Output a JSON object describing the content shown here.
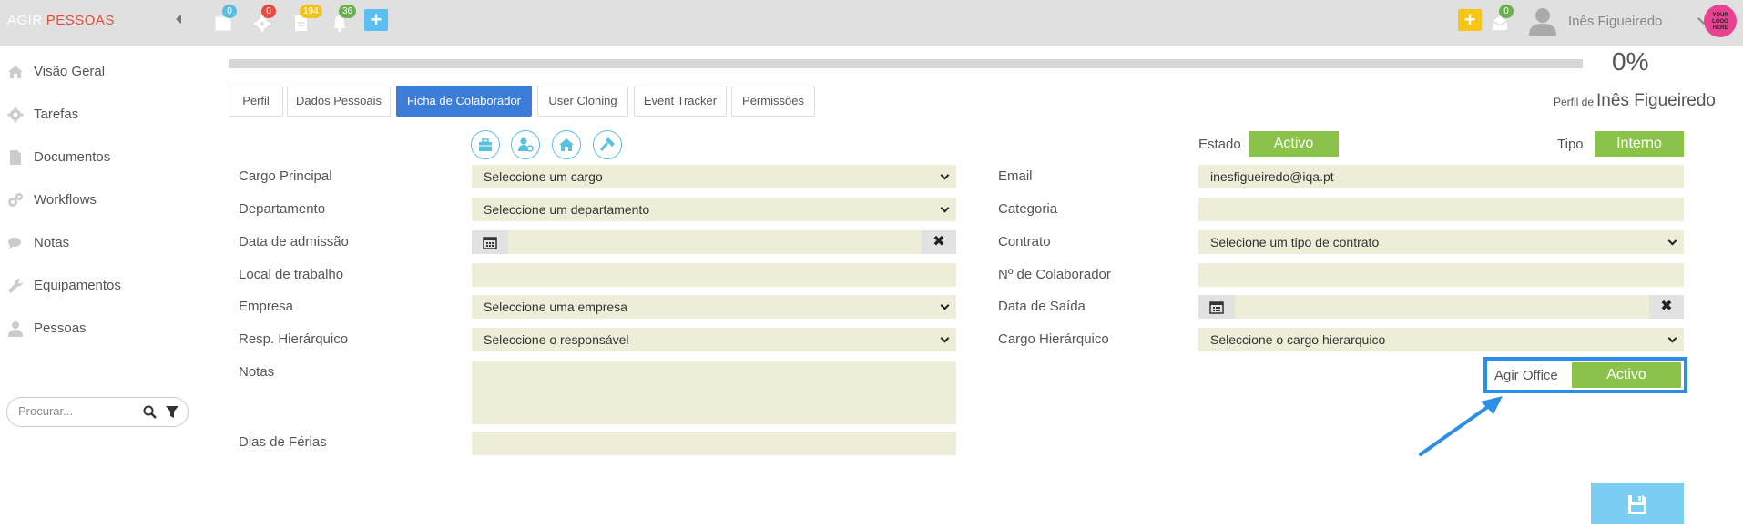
{
  "header": {
    "brand_part1": "AGIR",
    "brand_part2": "PESSOAS",
    "icons": [
      {
        "icon": "calendar-icon",
        "badge": "0"
      },
      {
        "icon": "gear-icon",
        "badge": "0"
      },
      {
        "icon": "document-icon",
        "badge": "194"
      },
      {
        "icon": "bell-icon",
        "badge": "36"
      }
    ],
    "plus_label": "+",
    "mail_badge": "0",
    "user_name": "Inês Figueiredo",
    "logo_text_1": "YOUR",
    "logo_text_2": "LOGO",
    "logo_text_3": "HERE"
  },
  "sidebar": {
    "items": [
      {
        "label": "Visão Geral",
        "icon": "home-icon"
      },
      {
        "label": "Tarefas",
        "icon": "gear-icon"
      },
      {
        "label": "Documentos",
        "icon": "document-icon"
      },
      {
        "label": "Workflows",
        "icon": "gears-icon"
      },
      {
        "label": "Notas",
        "icon": "chat-icon"
      },
      {
        "label": "Equipamentos",
        "icon": "wrench-icon"
      },
      {
        "label": "Pessoas",
        "icon": "user-icon"
      }
    ],
    "search_placeholder": "Procurar..."
  },
  "progress": {
    "value": 0,
    "label": "0%"
  },
  "tabs": [
    {
      "label": "Perfil",
      "active": false
    },
    {
      "label": "Dados Pessoais",
      "active": false
    },
    {
      "label": "Ficha de Colaborador",
      "active": true
    },
    {
      "label": "User Cloning",
      "active": false
    },
    {
      "label": "Event Tracker",
      "active": false
    },
    {
      "label": "Permissões",
      "active": false
    }
  ],
  "profile": {
    "prefix": "Perfil de",
    "name": "Inês Figueiredo"
  },
  "form": {
    "estado_label": "Estado",
    "estado_value": "Activo",
    "tipo_label": "Tipo",
    "tipo_value": "Interno",
    "cargo_principal": {
      "label": "Cargo Principal",
      "value": "Seleccione um cargo"
    },
    "departamento": {
      "label": "Departamento",
      "value": "Seleccione um departamento"
    },
    "data_admissao": {
      "label": "Data de admissão",
      "value": ""
    },
    "local_trabalho": {
      "label": "Local de trabalho",
      "value": ""
    },
    "empresa": {
      "label": "Empresa",
      "value": "Seleccione uma empresa"
    },
    "resp_hierarquico": {
      "label": "Resp. Hierárquico",
      "value": "Seleccione o responsável"
    },
    "notas": {
      "label": "Notas",
      "value": ""
    },
    "dias_ferias": {
      "label": "Dias de Férias",
      "value": ""
    },
    "email": {
      "label": "Email",
      "value": "inesfigueiredo@iqa.pt"
    },
    "categoria": {
      "label": "Categoria",
      "value": ""
    },
    "contrato": {
      "label": "Contrato",
      "value": "Selecione um tipo de contrato"
    },
    "num_colaborador": {
      "label": "Nº de Colaborador",
      "value": ""
    },
    "data_saida": {
      "label": "Data de Saída",
      "value": ""
    },
    "cargo_hierarquico": {
      "label": "Cargo Hierárquico",
      "value": "Seleccione o cargo hierarquico"
    },
    "agir_office": {
      "label": "Agir Office",
      "value": "Activo"
    },
    "clear_symbol": "✖"
  },
  "colors": {
    "accent_blue": "#3b7dd8",
    "green": "#8bc34a",
    "field_bg": "#eeeed8",
    "highlight": "#2d8ee6"
  }
}
